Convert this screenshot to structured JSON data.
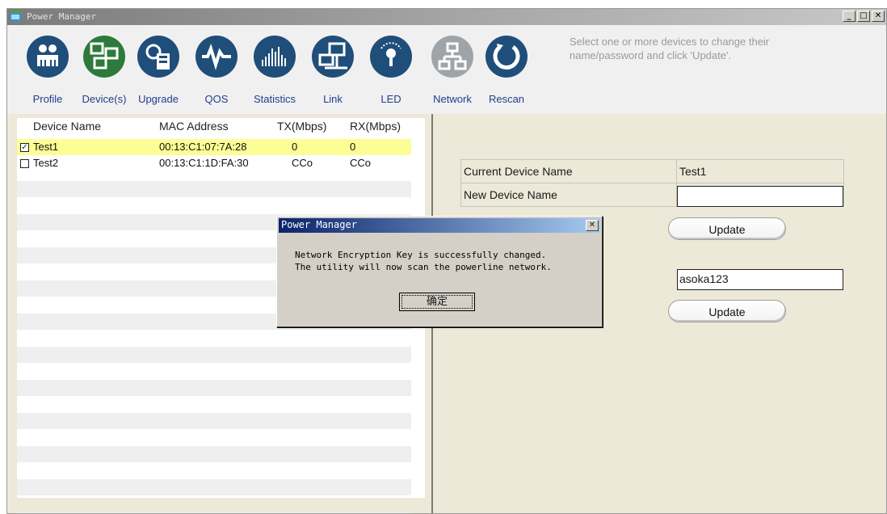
{
  "window": {
    "title": "Power Manager"
  },
  "toolbar": {
    "items": [
      {
        "label": "Profile",
        "icon": "people-icon"
      },
      {
        "label": "Device(s)",
        "icon": "devices-icon"
      },
      {
        "label": "Upgrade",
        "icon": "upgrade-icon"
      },
      {
        "label": "QOS",
        "icon": "pulse-icon"
      },
      {
        "label": "Statistics",
        "icon": "bars-icon"
      },
      {
        "label": "Link",
        "icon": "link-computer-icon"
      },
      {
        "label": "LED",
        "icon": "led-bulb-icon"
      },
      {
        "label": "Network",
        "icon": "network-icon"
      },
      {
        "label": "Rescan",
        "icon": "rescan-icon"
      }
    ],
    "instruction": "Select one or more devices to change their name/password and click 'Update'."
  },
  "device_list": {
    "headers": [
      "Device Name",
      "MAC Address",
      "TX(Mbps)",
      "RX(Mbps)"
    ],
    "rows": [
      {
        "checked": true,
        "name": "Test1",
        "mac": "00:13:C1:07:7A:28",
        "tx": "0",
        "rx": "0"
      },
      {
        "checked": false,
        "name": "Test2",
        "mac": "00:13:C1:1D:FA:30",
        "tx": "CCo",
        "rx": "CCo"
      }
    ],
    "check_mark": "✓"
  },
  "details": {
    "current_device_label": "Current Device Name",
    "current_device_value": "Test1",
    "new_device_label": "New Device Name",
    "new_device_value": "",
    "update_label": "Update",
    "password_value": "asoka123",
    "update2_label": "Update"
  },
  "dialog": {
    "title": "Power Manager",
    "message": "Network Encryption Key is successfully changed.\nThe utility will now scan the powerline network.",
    "ok_label": "确定",
    "close_symbol": "✕"
  },
  "window_controls": {
    "minimize": "_",
    "maximize": "□",
    "close": "✕"
  },
  "colors": {
    "selected_row": "#fdfd96",
    "toolbar_icon": "#1f4e7a",
    "active_icon": "#2d7a3a",
    "label": "#1f3e8a"
  }
}
